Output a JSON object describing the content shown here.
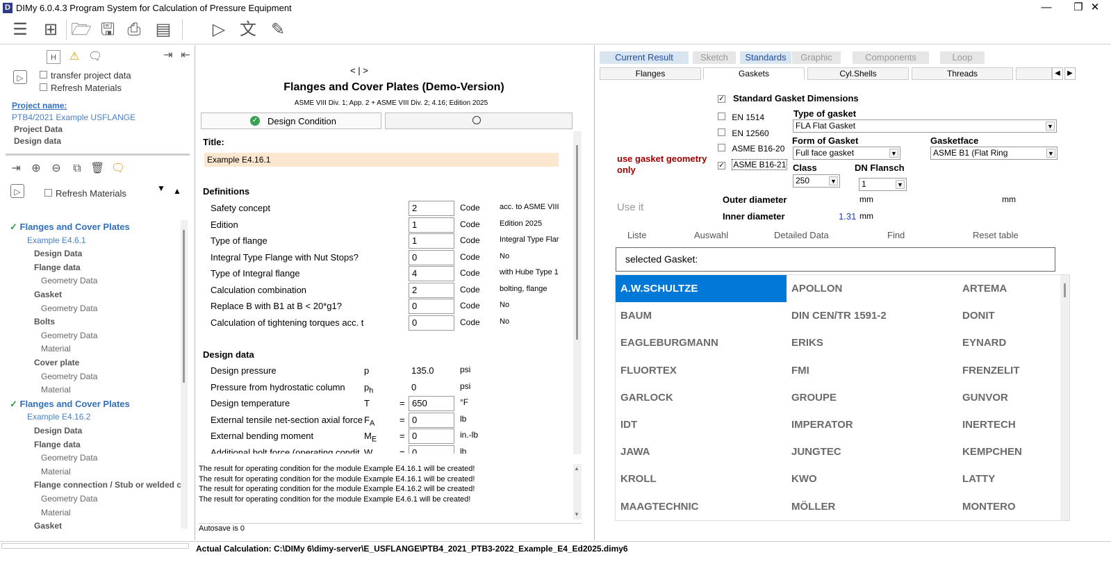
{
  "window": {
    "title": "DIMy 6.0.4.3 Program System for Calculation of Pressure Equipment",
    "app_icon": "D",
    "minimize": "—",
    "maximize": "❐",
    "close": "✕"
  },
  "toolbar": {
    "icons": [
      "menu-icon",
      "grid-icon",
      "open-folder-icon",
      "save-icon",
      "print-icon",
      "cabinet-icon",
      "run-settings-icon",
      "translate-icon",
      "edit-icon"
    ]
  },
  "left": {
    "transfer_label": "transfer project data",
    "refresh_label": "Refresh Materials",
    "project_name_label": "Project name:",
    "project_name": "PTB4/2021 Example USFLANGE",
    "project_data": "Project Data",
    "design_data": "Design data",
    "refresh_label2": "Refresh Materials",
    "tree": [
      {
        "lvl": "t1",
        "text": "Flanges and Cover Plates",
        "check": true
      },
      {
        "lvl": "t2",
        "text": "Example E4.6.1"
      },
      {
        "lvl": "t3",
        "text": "Design Data"
      },
      {
        "lvl": "t3",
        "text": "Flange data"
      },
      {
        "lvl": "t4",
        "text": "Geometry Data"
      },
      {
        "lvl": "t3",
        "text": "Gasket"
      },
      {
        "lvl": "t4",
        "text": "Geometry Data"
      },
      {
        "lvl": "t3",
        "text": "Bolts"
      },
      {
        "lvl": "t4",
        "text": "Geometry Data"
      },
      {
        "lvl": "t4",
        "text": "Material"
      },
      {
        "lvl": "t3",
        "text": "Cover plate"
      },
      {
        "lvl": "t4",
        "text": "Geometry Data"
      },
      {
        "lvl": "t4",
        "text": "Material"
      },
      {
        "lvl": "t1",
        "text": "Flanges and Cover Plates",
        "check": true
      },
      {
        "lvl": "t2",
        "text": "Example E4.16.2"
      },
      {
        "lvl": "t3",
        "text": "Design Data"
      },
      {
        "lvl": "t3",
        "text": "Flange data"
      },
      {
        "lvl": "t4",
        "text": "Geometry Data"
      },
      {
        "lvl": "t4",
        "text": "Material"
      },
      {
        "lvl": "t3",
        "text": "Flange connection / Stub or welded co"
      },
      {
        "lvl": "t4",
        "text": "Geometry Data"
      },
      {
        "lvl": "t4",
        "text": "Material"
      },
      {
        "lvl": "t3",
        "text": "Gasket"
      }
    ]
  },
  "mid": {
    "nav": "<  |  >",
    "heading": "Flanges and Cover Plates (Demo-Version)",
    "subheading": "ASME VIII Div. 1; App. 2 + ASME VIII Div. 2; 4.16;  Edition 2025",
    "tab1": "Design Condition",
    "title_label": "Title:",
    "title_value": "Example E4.16.1",
    "definitions_label": "Definitions",
    "code": "Code",
    "definitions": [
      {
        "label": "Safety concept",
        "value": "2",
        "desc": "acc. to ASME VIII"
      },
      {
        "label": "Edition",
        "value": "1",
        "desc": "Edition 2025"
      },
      {
        "label": "Type of flange",
        "value": "1",
        "desc": "Integral Type Flar"
      },
      {
        "label": "Integral Type Flange with Nut Stops?",
        "value": "0",
        "desc": "No"
      },
      {
        "label": "Type of Integral flange",
        "value": "4",
        "desc": "with Hube Type 1"
      },
      {
        "label": "Calculation combination",
        "value": "2",
        "desc": "bolting, flange"
      },
      {
        "label": "Replace B with B1 at B < 20*g1?",
        "value": "0",
        "desc": "No"
      },
      {
        "label": "Calculation of tightening torques acc. t",
        "value": "0",
        "desc": "No"
      }
    ],
    "design_label": "Design data",
    "design": [
      {
        "label": "Design pressure",
        "sym": "p",
        "sub": "",
        "eq": "",
        "value": "135.0",
        "unit": "psi",
        "box": false
      },
      {
        "label": "Pressure from hydrostatic column",
        "sym": "p",
        "sub": "h",
        "eq": "",
        "value": "0",
        "unit": "psi",
        "box": false
      },
      {
        "label": "Design temperature",
        "sym": "T",
        "sub": "",
        "eq": "=",
        "value": "650",
        "unit": "°F",
        "box": true
      },
      {
        "label": "External tensile net-section axial force",
        "sym": "F",
        "sub": "A",
        "eq": "=",
        "value": "0",
        "unit": "lb",
        "box": true
      },
      {
        "label": "External bending moment",
        "sym": "M",
        "sub": "E",
        "eq": "=",
        "value": "0",
        "unit": "in.-lb",
        "box": true
      },
      {
        "label": "Additional bolt force (operating condit",
        "sym": "W",
        "sub": "",
        "eq": "=",
        "value": "0",
        "unit": "lb",
        "box": true
      }
    ],
    "log": [
      "The result for operating condition for the module Example E4.16.1 will be created!",
      "The result for operating condition for the module Example E4.16.1 will be created!",
      "The result for operating condition for the module Example E4.16.2 will be created!",
      "The result for operating condition for the module Example E4.6.1 will be created!"
    ],
    "autosave": "Autosave is 0"
  },
  "right": {
    "tabs": [
      "Current Result",
      "Sketch",
      "Standards",
      "Graphic",
      "Components",
      "Loop"
    ],
    "subtabs": [
      "Flanges",
      "Gaskets",
      "Cyl.Shells",
      "Threads"
    ],
    "std_dims_label": "Standard Gasket Dimensions",
    "standards": [
      {
        "label": "EN 1514",
        "checked": false
      },
      {
        "label": "EN 12560",
        "checked": false
      },
      {
        "label": "ASME B16-20",
        "checked": false
      },
      {
        "label": "ASME B16-21",
        "checked": true
      }
    ],
    "use_geometry": "use gasket geometry only",
    "use_it": "Use it",
    "type_label": "Type of gasket",
    "type_value": "FLA Flat Gasket",
    "form_label": "Form of Gasket",
    "form_value": "Full face gasket",
    "face_label": "Gasketface",
    "face_value": "ASME B1 (Flat Ring",
    "class_label": "Class",
    "class_value": "250",
    "dn_label": "DN Flansch",
    "dn_value": "1",
    "outer_label": "Outer diameter",
    "inner_label": "Inner diameter",
    "inner_value": "1.31",
    "unit_mm": "mm",
    "actions": [
      "Liste",
      "Auswahl",
      "Detailed Data",
      "Find",
      "Reset table"
    ],
    "selected_label": "selected Gasket:",
    "gaskets": [
      [
        "A.W.SCHULTZE",
        "APOLLON",
        "ARTEMA"
      ],
      [
        "BAUM",
        "DIN CEN/TR 1591-2",
        "DONIT"
      ],
      [
        "EAGLEBURGMANN",
        "ERIKS",
        "EYNARD"
      ],
      [
        "FLUORTEX",
        "FMI",
        "FRENZELIT"
      ],
      [
        "GARLOCK",
        "GROUPE",
        "GUNVOR"
      ],
      [
        "IDT",
        "IMPERATOR",
        "INERTECH"
      ],
      [
        "JAWA",
        "JUNGTEC",
        "KEMPCHEN"
      ],
      [
        "KROLL",
        "KWO",
        "LATTY"
      ],
      [
        "MAAGTECHNIC",
        "MÖLLER",
        "MONTERO"
      ]
    ]
  },
  "status": {
    "actual": "Actual Calculation: C:\\DIMy 6\\dimy-server\\E_USFLANGE\\PTB4_2021_PTB3-2022_Example_E4_Ed2025.dimy6"
  }
}
